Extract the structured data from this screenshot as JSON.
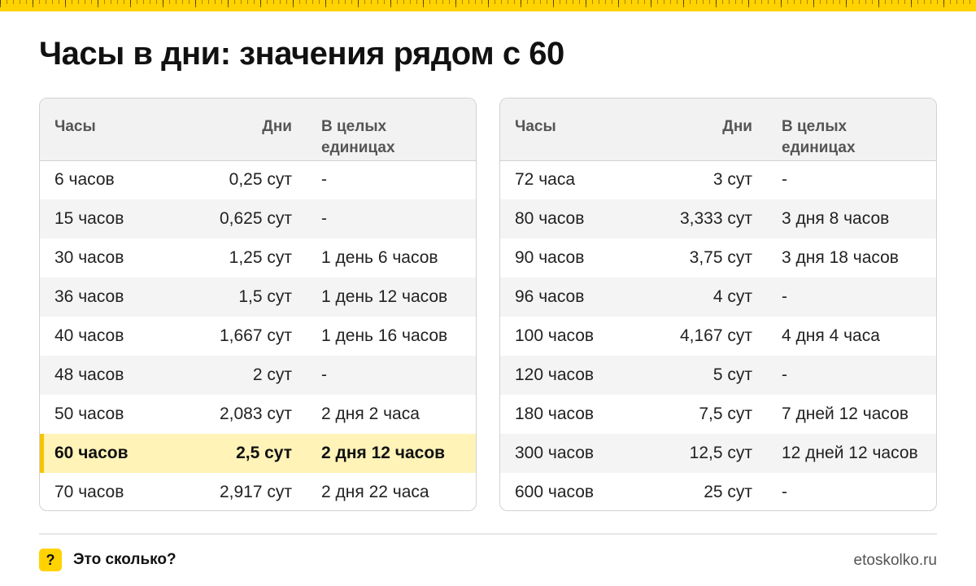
{
  "title": "Часы в дни: значения рядом с 60",
  "colors": {
    "accent": "#FFD200",
    "highlight_row": "#FFF3B8",
    "header_bg": "#F2F2F2",
    "zebra": "#F4F4F4",
    "border": "#D2D2D2"
  },
  "columns": {
    "hours": "Часы",
    "days": "Дни",
    "whole_line1": "В целых",
    "whole_line2": "единицах"
  },
  "tables": [
    {
      "rows": [
        {
          "hours": "6 часов",
          "days": "0,25 сут",
          "whole": "-"
        },
        {
          "hours": "15 часов",
          "days": "0,625 сут",
          "whole": "-"
        },
        {
          "hours": "30 часов",
          "days": "1,25 сут",
          "whole": "1 день 6 часов"
        },
        {
          "hours": "36 часов",
          "days": "1,5 сут",
          "whole": "1 день 12 часов"
        },
        {
          "hours": "40 часов",
          "days": "1,667 сут",
          "whole": "1 день 16 часов"
        },
        {
          "hours": "48 часов",
          "days": "2 сут",
          "whole": "-"
        },
        {
          "hours": "50 часов",
          "days": "2,083 сут",
          "whole": "2 дня 2 часа"
        },
        {
          "hours": "60 часов",
          "days": "2,5 сут",
          "whole": "2 дня 12 часов",
          "highlight": true
        },
        {
          "hours": "70 часов",
          "days": "2,917 сут",
          "whole": "2 дня 22 часа"
        }
      ]
    },
    {
      "rows": [
        {
          "hours": "72 часа",
          "days": "3 сут",
          "whole": "-"
        },
        {
          "hours": "80 часов",
          "days": "3,333 сут",
          "whole": "3 дня 8 часов"
        },
        {
          "hours": "90 часов",
          "days": "3,75 сут",
          "whole": "3 дня 18 часов"
        },
        {
          "hours": "96 часов",
          "days": "4 сут",
          "whole": "-"
        },
        {
          "hours": "100 часов",
          "days": "4,167 сут",
          "whole": "4 дня 4 часа"
        },
        {
          "hours": "120 часов",
          "days": "5 сут",
          "whole": "-"
        },
        {
          "hours": "180 часов",
          "days": "7,5 сут",
          "whole": "7 дней 12 часов"
        },
        {
          "hours": "300 часов",
          "days": "12,5 сут",
          "whole": "12 дней 12 часов"
        },
        {
          "hours": "600 часов",
          "days": "25 сут",
          "whole": "-"
        }
      ]
    }
  ],
  "footer": {
    "badge": "?",
    "brand": "Это сколько?",
    "site": "etoskolko.ru"
  }
}
